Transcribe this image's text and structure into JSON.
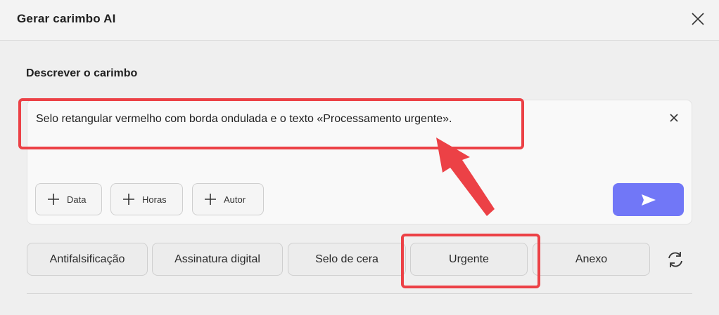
{
  "window": {
    "title": "Gerar carimbo AI"
  },
  "describe": {
    "label": "Descrever o carimbo",
    "prompt_text": "Selo retangular vermelho com borda ondulada e o texto «Processamento urgente».",
    "chips": [
      {
        "label": "Data",
        "icon": "plus-icon"
      },
      {
        "label": "Horas",
        "icon": "plus-icon"
      },
      {
        "label": "Autor",
        "icon": "plus-icon"
      }
    ],
    "send_icon": "send-icon"
  },
  "tags": [
    "Antifalsificação",
    "Assinatura digital",
    "Selo de cera",
    "Urgente",
    "Anexo"
  ],
  "icons": {
    "close": "close-icon",
    "clear": "close-icon",
    "refresh": "refresh-icon"
  },
  "colors": {
    "accent_send": "#7177f7",
    "annotation": "#ec4146"
  }
}
